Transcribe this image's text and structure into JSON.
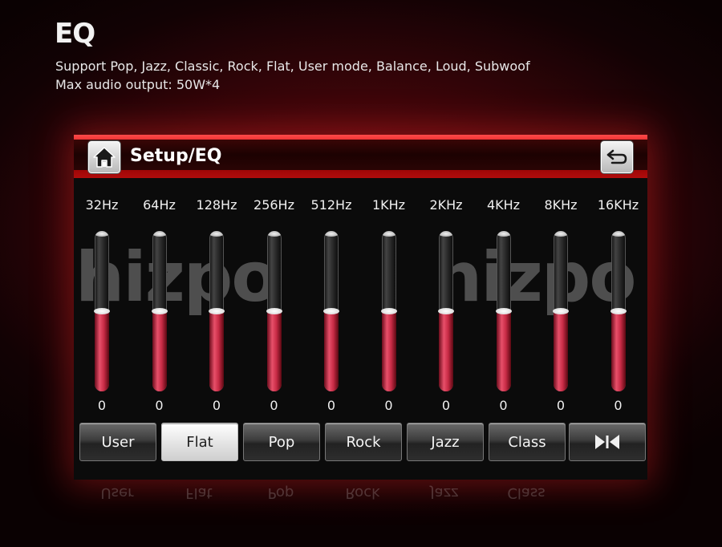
{
  "promo": {
    "title": "EQ",
    "line1": "Support Pop, Jazz, Classic, Rock, Flat, User mode, Balance, Loud, Subwoof",
    "line2": "Max audio output: 50W*4"
  },
  "screen": {
    "title": "Setup/EQ",
    "home_icon": "home-icon",
    "back_icon": "return-arrow-icon",
    "watermark": "hizpo"
  },
  "bands": [
    {
      "freq": "32Hz",
      "value": "0",
      "level": 0.5
    },
    {
      "freq": "64Hz",
      "value": "0",
      "level": 0.5
    },
    {
      "freq": "128Hz",
      "value": "0",
      "level": 0.5
    },
    {
      "freq": "256Hz",
      "value": "0",
      "level": 0.5
    },
    {
      "freq": "512Hz",
      "value": "0",
      "level": 0.5
    },
    {
      "freq": "1KHz",
      "value": "0",
      "level": 0.5
    },
    {
      "freq": "2KHz",
      "value": "0",
      "level": 0.5
    },
    {
      "freq": "4KHz",
      "value": "0",
      "level": 0.5
    },
    {
      "freq": "8KHz",
      "value": "0",
      "level": 0.5
    },
    {
      "freq": "16KHz",
      "value": "0",
      "level": 0.5
    }
  ],
  "presets": [
    {
      "label": "User",
      "active": false
    },
    {
      "label": "Flat",
      "active": true
    },
    {
      "label": "Pop",
      "active": false
    },
    {
      "label": "Rock",
      "active": false
    },
    {
      "label": "Jazz",
      "active": false
    },
    {
      "label": "Class",
      "active": false
    }
  ],
  "balance_button_icon": "balance-fader-icon",
  "colors": {
    "accent_red": "#d01010",
    "fill_red": "#e8506a",
    "active_preset": "#e6e6e6"
  }
}
